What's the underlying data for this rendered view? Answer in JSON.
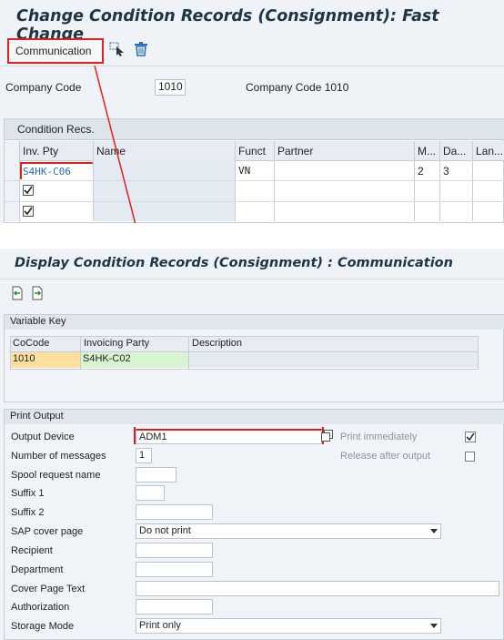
{
  "change_screen": {
    "title": "Change Condition Records (Consignment): Fast Change",
    "communication_button": "Communication",
    "company_code_label": "Company Code",
    "company_code_value": "1010",
    "company_code_desc": "Company Code 1010",
    "tab_label": "Condition Recs.",
    "columns": [
      "Inv. Pty",
      "Name",
      "Funct",
      "Partner",
      "M...",
      "Da...",
      "Lan..."
    ],
    "rows": [
      {
        "inv_pty": "S4HK-C06",
        "name": "",
        "funct": "VN",
        "partner": "",
        "m": "2",
        "da": "3",
        "lan": ""
      },
      {
        "inv_pty": "",
        "name": "",
        "funct": "",
        "partner": "",
        "m": "",
        "da": "",
        "lan": ""
      },
      {
        "inv_pty": "",
        "name": "",
        "funct": "",
        "partner": "",
        "m": "",
        "da": "",
        "lan": ""
      }
    ]
  },
  "display_screen": {
    "title": "Display Condition Records (Consignment) : Communication",
    "variable_key_title": "Variable Key",
    "vk_columns": [
      "CoCode",
      "Invoicing Party",
      "Description"
    ],
    "vk_row": {
      "cocode": "1010",
      "invoicing_party": "S4HK-C02",
      "description": ""
    },
    "print_output_title": "Print Output",
    "fields": {
      "output_device_label": "Output Device",
      "output_device_value": "ADM1",
      "number_of_messages_label": "Number of messages",
      "number_of_messages_value": "1",
      "spool_request_label": "Spool request name",
      "suffix1_label": "Suffix 1",
      "suffix2_label": "Suffix 2",
      "sap_cover_page_label": "SAP cover page",
      "sap_cover_page_value": "Do not print",
      "recipient_label": "Recipient",
      "department_label": "Department",
      "cover_page_text_label": "Cover Page Text",
      "authorization_label": "Authorization",
      "storage_mode_label": "Storage Mode",
      "storage_mode_value": "Print only",
      "print_immediately_label": "Print immediately",
      "print_immediately_checked": true,
      "release_after_output_label": "Release after output",
      "release_after_output_checked": false
    }
  },
  "colors": {
    "title_text": "#1f3444",
    "highlight_red": "#e0201b",
    "cocode_bg": "#fde0a0",
    "party_bg": "#d8f5d0",
    "link_blue": "#2a6db5"
  }
}
